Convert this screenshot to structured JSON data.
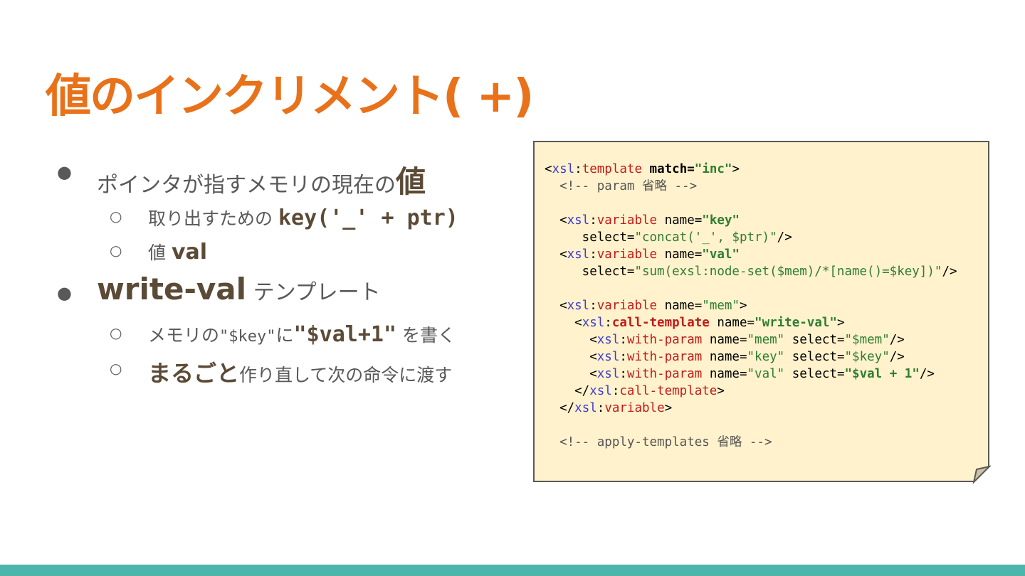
{
  "title": "値のインクリメント( +)",
  "bullets": {
    "item1": {
      "prefix": "ポインタが指すメモリの現在の",
      "emph": "値"
    },
    "item1_sub1": {
      "prefix": "取り出すための ",
      "code": "key('_' + ptr)"
    },
    "item1_sub2": {
      "prefix": "値 ",
      "emph": "val"
    },
    "item2": {
      "emph": "write-val",
      "suffix": " テンプレート"
    },
    "item2_sub1": {
      "prefix": "メモリの",
      "mono": "\"$key\"",
      "mid": "に",
      "code": "\"$val+1\"",
      "suffix": " を書く"
    },
    "item2_sub2": {
      "emph": "まるごと",
      "suffix": "作り直して次の命令に渡す"
    }
  },
  "code": {
    "comment1": "<!-- param 省略 -->",
    "template_match": "inc",
    "var_key_name": "key",
    "var_key_select": "concat('_', $ptr)",
    "var_val_name": "val",
    "var_val_select": "sum(exsl:node-set($mem)/*[name()=$key])",
    "var_mem_name": "mem",
    "call_template_name": "write-val",
    "param_mem_select": "$mem",
    "param_key_select": "$key",
    "param_val_select": "$val + 1",
    "comment2": "<!-- apply-templates 省略 -->"
  },
  "colors": {
    "title": "#e8711a",
    "note_bg": "#fff2cc",
    "footer": "#4db6ac"
  }
}
